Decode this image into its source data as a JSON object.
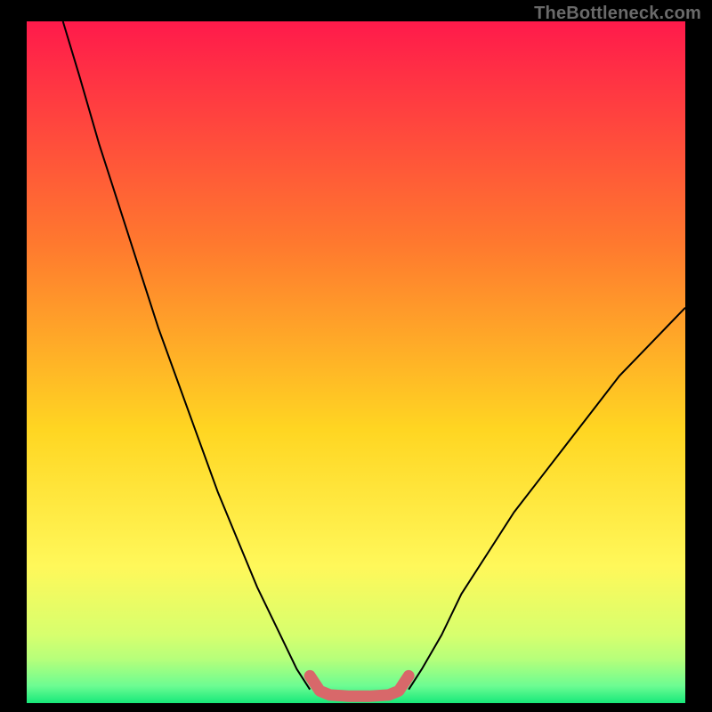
{
  "watermark": "TheBottleneck.com",
  "chart_data": {
    "type": "line",
    "title": "",
    "xlabel": "",
    "ylabel": "",
    "xlim": [
      0,
      100
    ],
    "ylim": [
      0,
      100
    ],
    "legend": false,
    "axes_visible": false,
    "background_gradient": {
      "direction": "vertical",
      "stops": [
        {
          "pos": 0.0,
          "color": "#ff1a4b"
        },
        {
          "pos": 0.33,
          "color": "#ff7a2e"
        },
        {
          "pos": 0.6,
          "color": "#ffd622"
        },
        {
          "pos": 0.8,
          "color": "#fff85a"
        },
        {
          "pos": 0.9,
          "color": "#d7ff6e"
        },
        {
          "pos": 0.935,
          "color": "#b7ff7a"
        },
        {
          "pos": 0.975,
          "color": "#6cfc92"
        },
        {
          "pos": 1.0,
          "color": "#17e87a"
        }
      ]
    },
    "series": [
      {
        "name": "left-curve",
        "color": "#000000",
        "width": 2,
        "x": [
          5.5,
          8,
          11,
          14,
          17,
          20,
          23,
          26,
          29,
          32,
          35,
          38,
          41,
          43
        ],
        "values": [
          100,
          92,
          82,
          73,
          64,
          55,
          47,
          39,
          31,
          24,
          17,
          11,
          5,
          2
        ]
      },
      {
        "name": "right-curve",
        "color": "#000000",
        "width": 2,
        "x": [
          58,
          60,
          63,
          66,
          70,
          74,
          78,
          82,
          86,
          90,
          94,
          98,
          100
        ],
        "values": [
          2,
          5,
          10,
          16,
          22,
          28,
          33,
          38,
          43,
          48,
          52,
          56,
          58
        ]
      },
      {
        "name": "valley-highlight",
        "color": "#d8686a",
        "width": 13,
        "linecap": "round",
        "x": [
          43,
          44.5,
          46,
          49,
          52,
          55,
          56.5,
          58
        ],
        "values": [
          4,
          1.8,
          1.2,
          1,
          1,
          1.2,
          1.8,
          4
        ]
      }
    ],
    "annotations": []
  }
}
